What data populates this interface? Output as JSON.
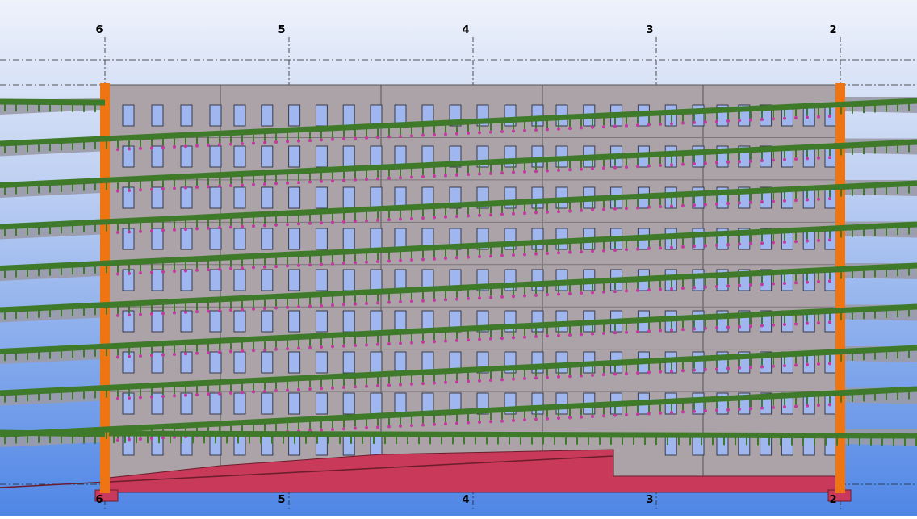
{
  "view": {
    "type": "building elevation 3D model view",
    "background_gradient": [
      "#eef2fb",
      "#4f86e6"
    ],
    "colors": {
      "facade": "#aba3a7",
      "window": "#9fb7ee",
      "frame": "#3a3a4a",
      "plinth": "#c9395a",
      "column": "#ef7412",
      "truss": "#3f7a2a",
      "fixture": "#c23aa0",
      "slab": "#9a9aa6"
    },
    "floor_count": 9,
    "window_bays": 5
  },
  "grid_axes": {
    "top_labels": [
      "6",
      "5",
      "4",
      "3",
      "2"
    ],
    "bottom_labels": [
      "6",
      "5",
      "4",
      "3",
      "2"
    ]
  }
}
